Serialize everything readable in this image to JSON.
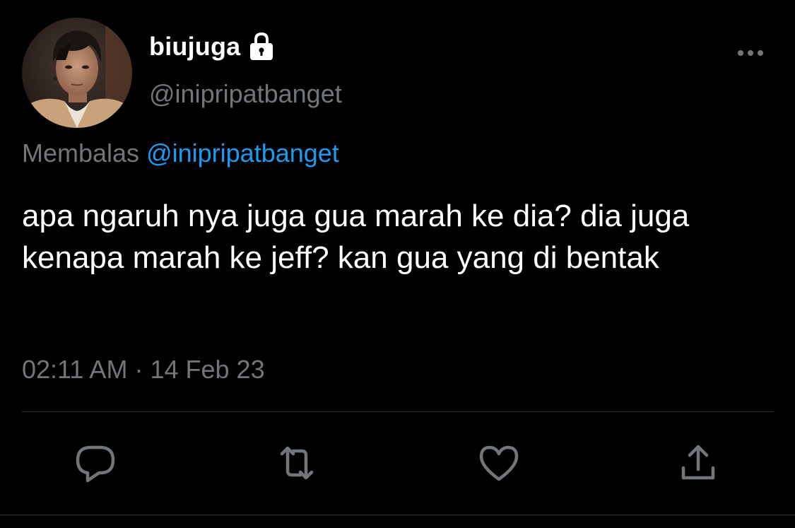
{
  "user": {
    "display_name": "biujuga",
    "handle": "@inipripatbanget",
    "protected_icon": "lock-icon"
  },
  "reply_context": {
    "prefix": "Membalas",
    "mention": "@inipripatbanget"
  },
  "tweet": {
    "text": "apa ngaruh nya juga gua marah ke dia? dia juga kenapa marah ke jeff? kan gua yang di bentak",
    "time": "02:11 AM",
    "separator": "·",
    "date": "14 Feb 23"
  },
  "actions": {
    "reply_icon": "reply-icon",
    "retweet_icon": "retweet-icon",
    "like_icon": "heart-icon",
    "share_icon": "share-icon"
  },
  "colors": {
    "background": "#000000",
    "text_primary": "#ffffff",
    "text_secondary": "#71767b",
    "link": "#1d9bf0",
    "divider": "#2f3336"
  }
}
